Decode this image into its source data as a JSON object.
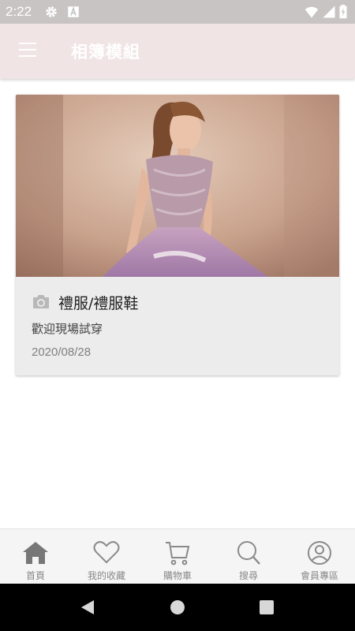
{
  "status_bar": {
    "time": "2:22",
    "icons": [
      "settings-icon",
      "a-badge-icon",
      "wifi-icon",
      "signal-icon",
      "battery-icon"
    ]
  },
  "app_bar": {
    "title": "相簿模組",
    "menu_icon": "hamburger-menu-icon"
  },
  "album": {
    "image": "dress-photo",
    "icon": "camera-icon",
    "title": "禮服/禮服鞋",
    "subtitle": "歡迎現場試穿",
    "date": "2020/08/28"
  },
  "bottom_nav": {
    "items": [
      {
        "label": "首頁",
        "icon": "home-icon"
      },
      {
        "label": "我的收藏",
        "icon": "heart-icon"
      },
      {
        "label": "購物車",
        "icon": "cart-icon"
      },
      {
        "label": "搜尋",
        "icon": "search-icon"
      },
      {
        "label": "會員專區",
        "icon": "member-icon"
      }
    ]
  },
  "colors": {
    "status_bar": "#c8c4c4",
    "app_bar": "#f1e4e4",
    "card": "#ececec",
    "nav_icon": "#8a8a8a",
    "home_icon": "#777777"
  }
}
